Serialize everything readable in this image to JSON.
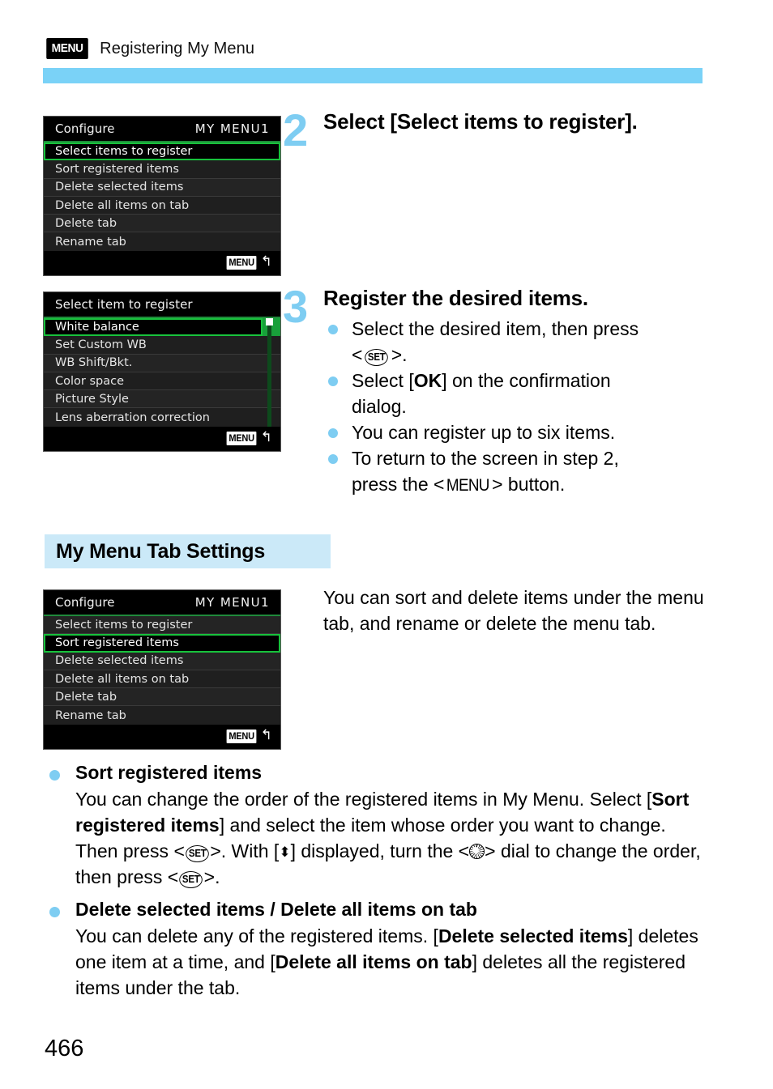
{
  "header": {
    "menu_badge": "MENU",
    "title": "Registering My Menu",
    "accent_bar_color": "#7ad2f7"
  },
  "page_number": "466",
  "colors": {
    "accent_light_blue": "#7ad2f7",
    "section_bar_blue": "#cbe9f8",
    "bullet_blue": "#7ecdf2",
    "camera_highlight_green": "#18c23c"
  },
  "steps": [
    {
      "number": "2",
      "title": "Select [Select items to register].",
      "bullets": []
    },
    {
      "number": "3",
      "title": "Register the desired items.",
      "bullets": [
        "Select the desired item, then press < SET >.",
        "Select [OK] on the confirmation dialog.",
        "You can register up to six items.",
        "To return to the screen in step 2, press the <MENU> button."
      ]
    }
  ],
  "camera_screens": [
    {
      "name": "configure-screen-step2",
      "title": "Configure",
      "tab": "MY MENU1",
      "rows": [
        "Select items to register",
        "Sort registered items",
        "Delete selected items",
        "Delete all items on tab",
        "Delete tab",
        "Rename tab"
      ],
      "selected_index": 0,
      "footer_badge": "MENU",
      "footer_arrow": "↰",
      "has_scrollbar": false
    },
    {
      "name": "select-item-to-register-screen",
      "title": "Select item to register",
      "tab": "",
      "rows": [
        "White balance",
        "Set Custom WB",
        "WB Shift/Bkt.",
        "Color space",
        "Picture Style",
        "Lens aberration correction"
      ],
      "selected_index": 0,
      "footer_badge": "MENU",
      "footer_arrow": "↰",
      "has_scrollbar": true
    },
    {
      "name": "configure-screen-tab-settings",
      "title": "Configure",
      "tab": "MY MENU1",
      "rows": [
        "Select items to register",
        "Sort registered items",
        "Delete selected items",
        "Delete all items on tab",
        "Delete tab",
        "Rename tab"
      ],
      "selected_index": 1,
      "footer_badge": "MENU",
      "footer_arrow": "↰",
      "has_scrollbar": false
    }
  ],
  "section": {
    "title": "My Menu Tab Settings",
    "intro": "You can sort and delete items under the menu tab, and rename or delete the menu tab."
  },
  "topics": [
    {
      "name": "sort-registered-items",
      "heading": "Sort registered items",
      "body_plain": "You can change the order of the registered items in My Menu. Select [Sort registered items] and select the item whose order you want to change. Then press <SET>. With [↕] displayed, turn the <dial> dial to change the order, then press <SET>."
    },
    {
      "name": "delete-items",
      "heading": "Delete selected items / Delete all items on tab",
      "body_plain": "You can delete any of the registered items. [Delete selected items] deletes one item at a time, and [Delete all items on tab] deletes all the registered items under the tab."
    }
  ]
}
